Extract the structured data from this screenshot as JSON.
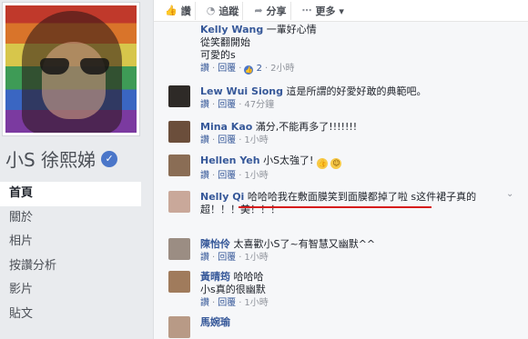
{
  "profile": {
    "name": "小S 徐熙娣",
    "nav": [
      "首頁",
      "關於",
      "相片",
      "按讚分析",
      "影片",
      "貼文"
    ]
  },
  "actions": [
    {
      "icon": "like-icon",
      "glyph": "👍",
      "label": "讚"
    },
    {
      "icon": "rss-icon",
      "glyph": "◔",
      "label": "追蹤"
    },
    {
      "icon": "share-icon",
      "glyph": "➦",
      "label": "分享"
    },
    {
      "icon": "more-icon",
      "glyph": "⋯",
      "label": "更多 ▾"
    }
  ],
  "comments": [
    {
      "name": "Kelly Wang",
      "text": "一輩好心情",
      "line2": "從笑翻開始",
      "line3": "可愛的s",
      "like": "讚",
      "reply": "回覆",
      "reactions": "2",
      "time": "2小時",
      "avatar_color": "#b07a68"
    },
    {
      "name": "Lew Wui Siong",
      "text": "這是所謂的好愛好敢的典範吧。",
      "like": "讚",
      "reply": "回覆",
      "time": "47分鐘",
      "avatar_color": "#2e2a27"
    },
    {
      "name": "Mina Kao",
      "text": "滿分,不能再多了!!!!!!!",
      "like": "讚",
      "reply": "回覆",
      "time": "1小時",
      "avatar_color": "#6b4e3b"
    },
    {
      "name": "Hellen Yeh",
      "text": "小S太強了!",
      "like": "讚",
      "reply": "回覆",
      "time": "1小時",
      "avatar_color": "#8a6d55"
    },
    {
      "name": "Nelly Qi",
      "text": "哈哈哈我在敷面膜笑到面膜都掉了啦 s这件裙子真的",
      "line2": "超！！！美！！！",
      "avatar_color": "#c9a89a"
    },
    {
      "name": "陳怡伶",
      "text": "太喜歡小S了~有智慧又幽默^^",
      "like": "讚",
      "reply": "回覆",
      "time": "1小時",
      "avatar_color": "#9b8d83"
    },
    {
      "name": "黃晴筠",
      "text": "哈哈哈",
      "line2": "小s真的很幽默",
      "like": "讚",
      "reply": "回覆",
      "time": "1小時",
      "avatar_color": "#a07b5c"
    },
    {
      "name": "馬婉瑜",
      "avatar_color": "#b89a86"
    }
  ]
}
